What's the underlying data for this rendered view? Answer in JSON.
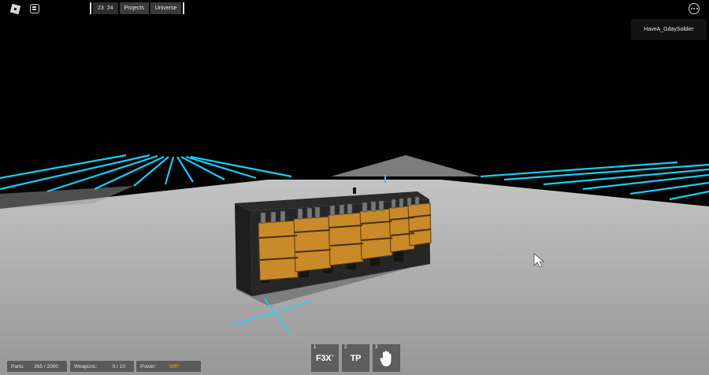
{
  "topbar": {
    "counter_a": "23",
    "counter_b": "24",
    "tabs": [
      {
        "label": "Projects"
      },
      {
        "label": "Universe"
      }
    ]
  },
  "player": {
    "name": "HaveA_GdaySoldier"
  },
  "status": {
    "parts": {
      "label": "Parts:",
      "value": "265 / 2000"
    },
    "weapons": {
      "label": "Weapons:",
      "value": "0 / 10"
    },
    "power": {
      "label": "Power:",
      "value": "WIP"
    }
  },
  "hotbar": [
    {
      "num": "1",
      "label": "F3X"
    },
    {
      "num": "2",
      "label": "TP"
    },
    {
      "num": "3",
      "label": ""
    }
  ],
  "icons": {
    "roblox": "roblox-logo-icon",
    "chat": "chat-icon",
    "menu": "more-options-icon",
    "hand": "hand-icon",
    "cursor": "mouse-cursor-icon"
  },
  "colors": {
    "neon": "#19d9ff",
    "floor": "#a9a9a9",
    "crate": "#c98a2a",
    "power_value": "#e2a23a"
  }
}
